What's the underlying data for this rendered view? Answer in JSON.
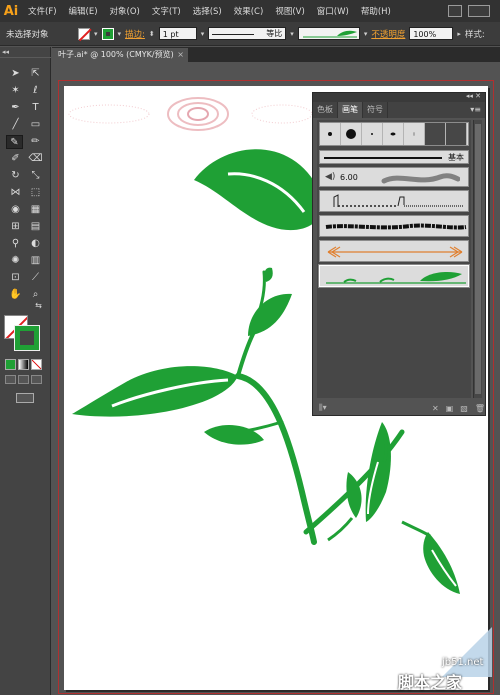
{
  "app": {
    "logo": "Ai"
  },
  "menu": [
    "文件(F)",
    "编辑(E)",
    "对象(O)",
    "文字(T)",
    "选择(S)",
    "效果(C)",
    "视图(V)",
    "窗口(W)",
    "帮助(H)"
  ],
  "control_bar": {
    "selection_status": "未选择对象",
    "stroke_label": "描边:",
    "stroke_weight": "1 pt",
    "profile_label": "等比",
    "opacity_label": "不透明度",
    "opacity_value": "100%",
    "style_label": "样式:"
  },
  "document_tab": {
    "title": "叶子.ai* @ 100% (CMYK/预览)",
    "close": "×"
  },
  "brush_panel": {
    "tabs": [
      "色板",
      "画笔",
      "符号"
    ],
    "active_tab": "画笔",
    "basic_label": "基本",
    "blob_size": "6.00"
  },
  "colors": {
    "leaf_green": "#1fa035",
    "accent_orange": "#f0a030",
    "artboard_border": "#b03030"
  },
  "icons": [
    "selection-tool",
    "direct-selection-tool",
    "magic-wand-tool",
    "lasso-tool",
    "pen-tool",
    "type-tool",
    "line-tool",
    "rectangle-tool",
    "paintbrush-tool",
    "pencil-tool",
    "blob-brush-tool",
    "eraser-tool",
    "rotate-tool",
    "scale-tool",
    "width-tool",
    "free-transform-tool",
    "shape-builder-tool",
    "perspective-grid-tool",
    "mesh-tool",
    "gradient-tool",
    "eyedropper-tool",
    "blend-tool",
    "symbol-sprayer-tool",
    "column-graph-tool",
    "artboard-tool",
    "slice-tool",
    "hand-tool",
    "zoom-tool"
  ],
  "watermark": {
    "url": "jb51.net",
    "name": "脚本之家"
  }
}
